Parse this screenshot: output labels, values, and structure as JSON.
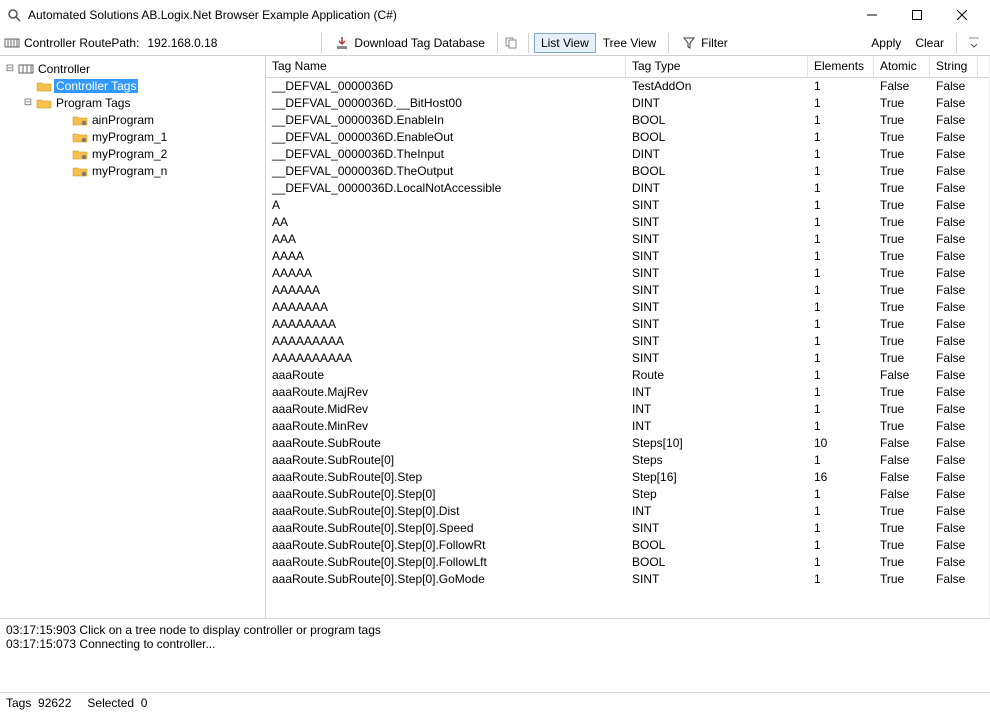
{
  "window": {
    "title": "Automated Solutions AB.Logix.Net Browser Example Application (C#)"
  },
  "toolbar": {
    "route_label": "Controller RoutePath:",
    "route_value": "192.168.0.18",
    "download": "Download Tag Database",
    "list_view": "List View",
    "tree_view": "Tree View",
    "filter": "Filter",
    "apply": "Apply",
    "clear": "Clear"
  },
  "tree": {
    "root": "Controller",
    "controller_tags": "Controller Tags",
    "program_tags": "Program Tags",
    "programs": [
      "ainProgram",
      "myProgram_1",
      "myProgram_2",
      "myProgram_n"
    ]
  },
  "columns": {
    "name": "Tag Name",
    "type": "Tag Type",
    "elements": "Elements",
    "atomic": "Atomic",
    "string": "String"
  },
  "rows": [
    {
      "name": "__DEFVAL_0000036D",
      "type": "TestAddOn",
      "elements": "1",
      "atomic": "False",
      "string": "False"
    },
    {
      "name": "__DEFVAL_0000036D.__BitHost00",
      "type": "DINT",
      "elements": "1",
      "atomic": "True",
      "string": "False"
    },
    {
      "name": "__DEFVAL_0000036D.EnableIn",
      "type": "BOOL",
      "elements": "1",
      "atomic": "True",
      "string": "False"
    },
    {
      "name": "__DEFVAL_0000036D.EnableOut",
      "type": "BOOL",
      "elements": "1",
      "atomic": "True",
      "string": "False"
    },
    {
      "name": "__DEFVAL_0000036D.TheInput",
      "type": "DINT",
      "elements": "1",
      "atomic": "True",
      "string": "False"
    },
    {
      "name": "__DEFVAL_0000036D.TheOutput",
      "type": "BOOL",
      "elements": "1",
      "atomic": "True",
      "string": "False"
    },
    {
      "name": "__DEFVAL_0000036D.LocalNotAccessible",
      "type": "DINT",
      "elements": "1",
      "atomic": "True",
      "string": "False"
    },
    {
      "name": "A",
      "type": "SINT",
      "elements": "1",
      "atomic": "True",
      "string": "False"
    },
    {
      "name": "AA",
      "type": "SINT",
      "elements": "1",
      "atomic": "True",
      "string": "False"
    },
    {
      "name": "AAA",
      "type": "SINT",
      "elements": "1",
      "atomic": "True",
      "string": "False"
    },
    {
      "name": "AAAA",
      "type": "SINT",
      "elements": "1",
      "atomic": "True",
      "string": "False"
    },
    {
      "name": "AAAAA",
      "type": "SINT",
      "elements": "1",
      "atomic": "True",
      "string": "False"
    },
    {
      "name": "AAAAAA",
      "type": "SINT",
      "elements": "1",
      "atomic": "True",
      "string": "False"
    },
    {
      "name": "AAAAAAA",
      "type": "SINT",
      "elements": "1",
      "atomic": "True",
      "string": "False"
    },
    {
      "name": "AAAAAAAA",
      "type": "SINT",
      "elements": "1",
      "atomic": "True",
      "string": "False"
    },
    {
      "name": "AAAAAAAAA",
      "type": "SINT",
      "elements": "1",
      "atomic": "True",
      "string": "False"
    },
    {
      "name": "AAAAAAAAAA",
      "type": "SINT",
      "elements": "1",
      "atomic": "True",
      "string": "False"
    },
    {
      "name": "aaaRoute",
      "type": "Route",
      "elements": "1",
      "atomic": "False",
      "string": "False"
    },
    {
      "name": "aaaRoute.MajRev",
      "type": "INT",
      "elements": "1",
      "atomic": "True",
      "string": "False"
    },
    {
      "name": "aaaRoute.MidRev",
      "type": "INT",
      "elements": "1",
      "atomic": "True",
      "string": "False"
    },
    {
      "name": "aaaRoute.MinRev",
      "type": "INT",
      "elements": "1",
      "atomic": "True",
      "string": "False"
    },
    {
      "name": "aaaRoute.SubRoute",
      "type": "Steps[10]",
      "elements": "10",
      "atomic": "False",
      "string": "False"
    },
    {
      "name": "aaaRoute.SubRoute[0]",
      "type": "Steps",
      "elements": "1",
      "atomic": "False",
      "string": "False"
    },
    {
      "name": "aaaRoute.SubRoute[0].Step",
      "type": "Step[16]",
      "elements": "16",
      "atomic": "False",
      "string": "False"
    },
    {
      "name": "aaaRoute.SubRoute[0].Step[0]",
      "type": "Step",
      "elements": "1",
      "atomic": "False",
      "string": "False"
    },
    {
      "name": "aaaRoute.SubRoute[0].Step[0].Dist",
      "type": "INT",
      "elements": "1",
      "atomic": "True",
      "string": "False"
    },
    {
      "name": "aaaRoute.SubRoute[0].Step[0].Speed",
      "type": "SINT",
      "elements": "1",
      "atomic": "True",
      "string": "False"
    },
    {
      "name": "aaaRoute.SubRoute[0].Step[0].FollowRt",
      "type": "BOOL",
      "elements": "1",
      "atomic": "True",
      "string": "False"
    },
    {
      "name": "aaaRoute.SubRoute[0].Step[0].FollowLft",
      "type": "BOOL",
      "elements": "1",
      "atomic": "True",
      "string": "False"
    },
    {
      "name": "aaaRoute.SubRoute[0].Step[0].GoMode",
      "type": "SINT",
      "elements": "1",
      "atomic": "True",
      "string": "False"
    }
  ],
  "log": [
    "03:17:15:903 Click on a tree node to display controller or program tags",
    "03:17:15:073 Connecting to controller..."
  ],
  "status": {
    "tags_label": "Tags",
    "tags_count": "92622",
    "selected_label": "Selected",
    "selected_count": "0"
  }
}
